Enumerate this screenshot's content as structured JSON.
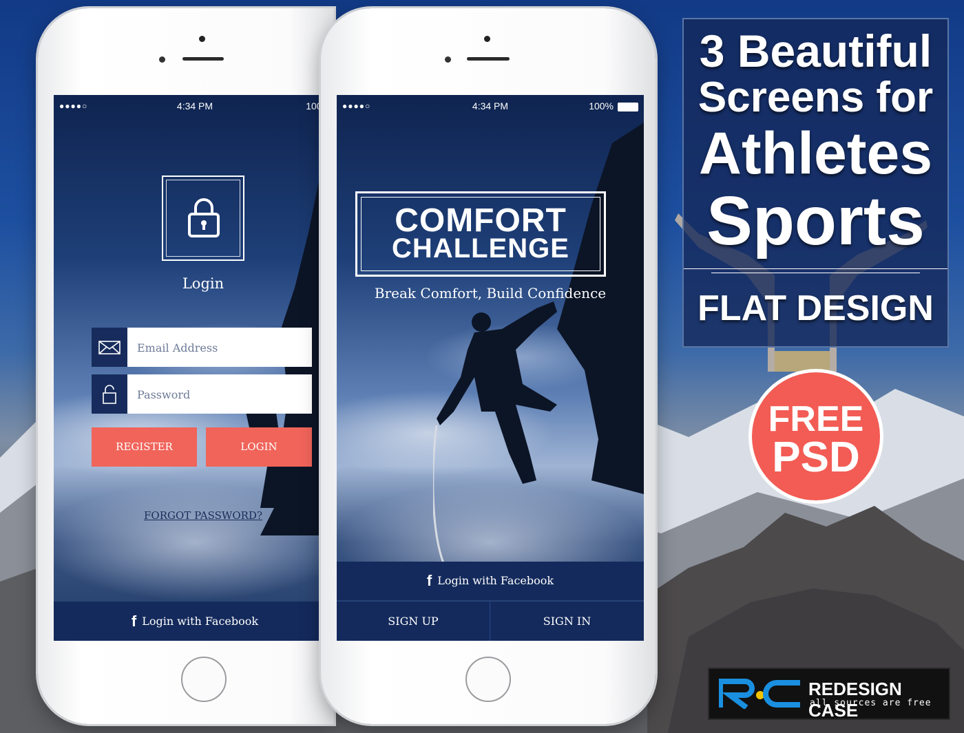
{
  "status_bar": {
    "signal": "●●●●○",
    "time": "4:34 PM",
    "battery": "100%"
  },
  "login_screen": {
    "title": "Login",
    "email_placeholder": "Email Address",
    "password_placeholder": "Password",
    "register_label": "REGISTER",
    "login_label": "LOGIN",
    "forgot_label": "FORGOT PASSWORD?",
    "facebook_label": "Login with Facebook"
  },
  "splash_screen": {
    "logo_line1": "COMFORT",
    "logo_line2": "CHALLENGE",
    "tagline": "Break Comfort, Build Confidence",
    "facebook_label": "Login with Facebook",
    "signup_label": "SIGN UP",
    "signin_label": "SIGN IN"
  },
  "promo": {
    "line1": "3 Beautiful",
    "line2": "Screens for",
    "line3": "Athletes",
    "line4": "Sports",
    "line5": "FLAT DESIGN"
  },
  "badge": {
    "line1": "FREE",
    "line2": "PSD"
  },
  "brand": {
    "name": "REDESIGN CASE",
    "tagline": "all sources are free"
  },
  "colors": {
    "navy": "#142a5c",
    "coral": "#f0645a",
    "badge": "#f25c54",
    "logo_blue": "#1a8fe0",
    "logo_yellow": "#f5c400"
  }
}
